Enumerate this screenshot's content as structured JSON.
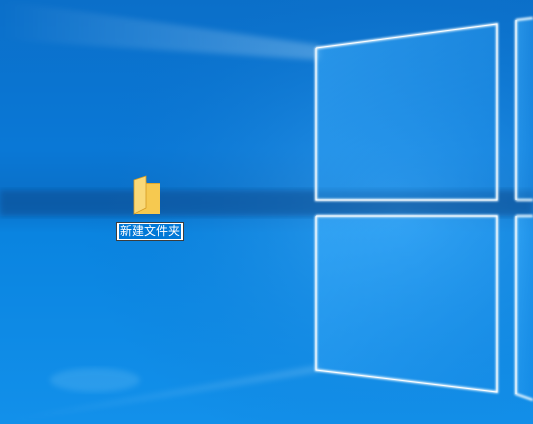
{
  "desktop": {
    "icons": [
      {
        "icon": "folder-icon",
        "label": "新建文件夹",
        "state": "renaming-selected"
      }
    ]
  },
  "colors": {
    "wallpaper_base": "#0a78d6",
    "wallpaper_light": "#bfe6ff",
    "selection": "#0078d7",
    "folder_yellow": "#f3c34a"
  }
}
